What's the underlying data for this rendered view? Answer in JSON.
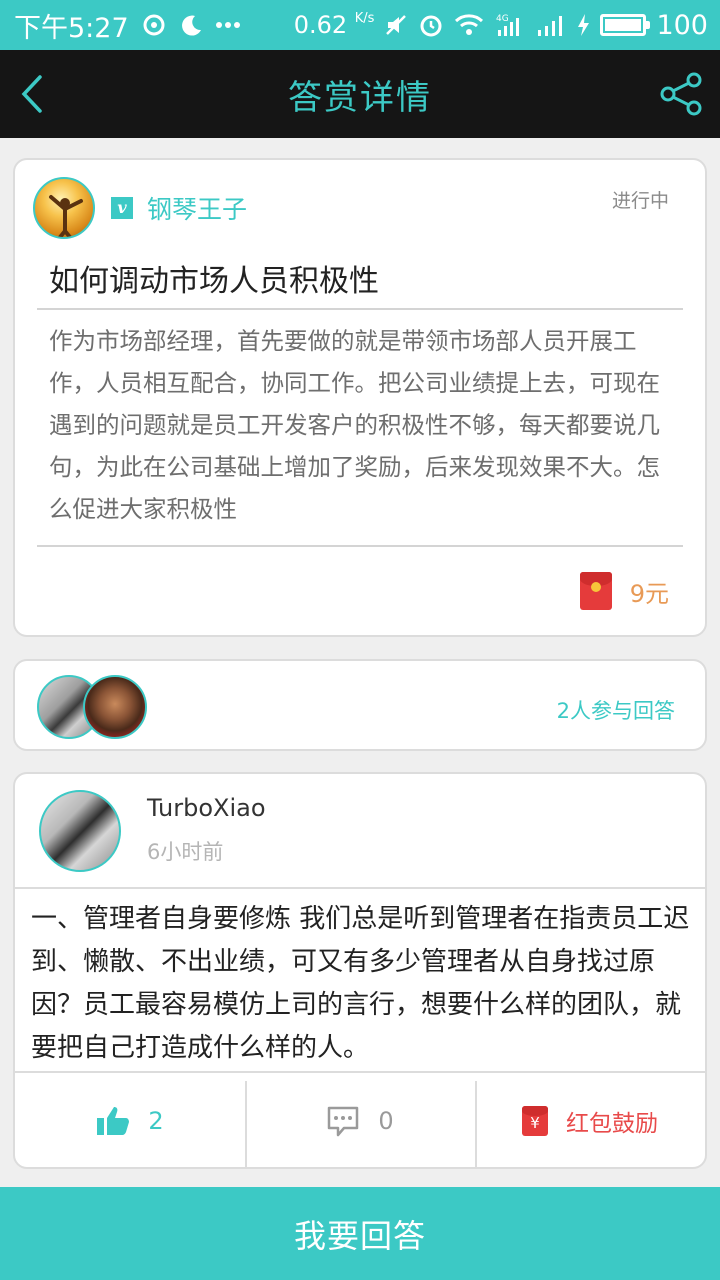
{
  "status_bar": {
    "time": "下午5:27",
    "speed_value": "0.62",
    "speed_unit": "K/s",
    "battery": "100",
    "network": "4G"
  },
  "nav": {
    "title": "答赏详情",
    "back_icon": "chevron-left-icon",
    "share_icon": "share-icon"
  },
  "question": {
    "username": "钢琴王子",
    "verified_badge": "v",
    "status": "进行中",
    "title": "如何调动市场人员积极性",
    "body": "作为市场部经理，首先要做的就是带领市场部人员开展工作，人员相互配合，协同工作。把公司业绩提上去，可现在遇到的问题就是员工开发客户的积极性不够，每天都要说几句，为此在公司基础上增加了奖励，后来发现效果不大。怎么促进大家积极性",
    "reward": "9元"
  },
  "participants": {
    "text": "2人参与回答"
  },
  "answer": {
    "username": "TurboXiao",
    "time": "6小时前",
    "body": "一、管理者自身要修炼 我们总是听到管理者在指责员工迟到、懒散、不出业绩，可又有多少管理者从自身找过原因？员工最容易模仿上司的言行，想要什么样的团队，就要把自己打造成什么样的人。",
    "likes": "2",
    "comments": "0",
    "redpack_label": "红包鼓励",
    "redpack_symbol": "¥"
  },
  "bottom_button": {
    "label": "我要回答"
  },
  "colors": {
    "accent": "#3cc9c5",
    "navbar": "#151515",
    "reward": "#e89a56",
    "red": "#e53b3b"
  }
}
